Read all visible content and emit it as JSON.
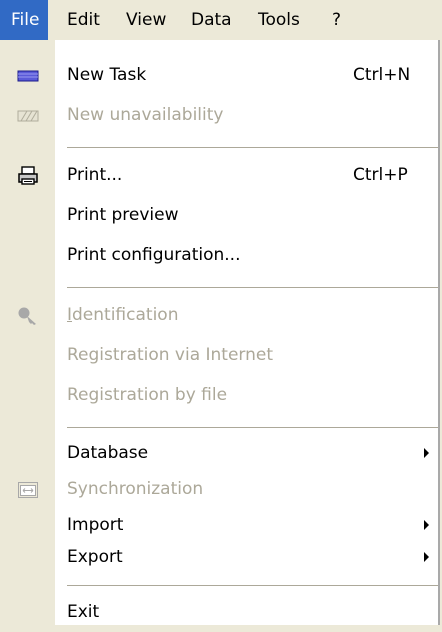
{
  "menubar": {
    "items": [
      {
        "label": "File"
      },
      {
        "label": "Edit"
      },
      {
        "label": "View"
      },
      {
        "label": "Data"
      },
      {
        "label": "Tools"
      },
      {
        "label": "?"
      }
    ]
  },
  "file_menu": {
    "new_task": {
      "label": "New Task",
      "shortcut": "Ctrl+N",
      "icon": "task-icon"
    },
    "new_unavailability": {
      "label": "New unavailability",
      "enabled": false,
      "icon": "unavailability-icon"
    },
    "print": {
      "label": "Print...",
      "shortcut": "Ctrl+P",
      "icon": "printer-icon"
    },
    "print_preview": {
      "label": "Print preview"
    },
    "print_configuration": {
      "label": "Print configuration..."
    },
    "identification": {
      "label_first": "I",
      "label_rest": "dentification",
      "enabled": false,
      "icon": "key-icon"
    },
    "registration_internet": {
      "label": "Registration via Internet",
      "enabled": false
    },
    "registration_file": {
      "label": "Registration by file",
      "enabled": false
    },
    "database": {
      "label": "Database",
      "has_submenu": true
    },
    "synchronization": {
      "label": "Synchronization",
      "enabled": false,
      "icon": "sync-icon"
    },
    "import": {
      "label": "Import",
      "has_submenu": true
    },
    "export": {
      "label": "Export",
      "has_submenu": true
    },
    "exit": {
      "label": "Exit"
    }
  },
  "colors": {
    "highlight": "#316ac5",
    "gutter": "#ece9d8",
    "disabled_text": "#aca899"
  }
}
